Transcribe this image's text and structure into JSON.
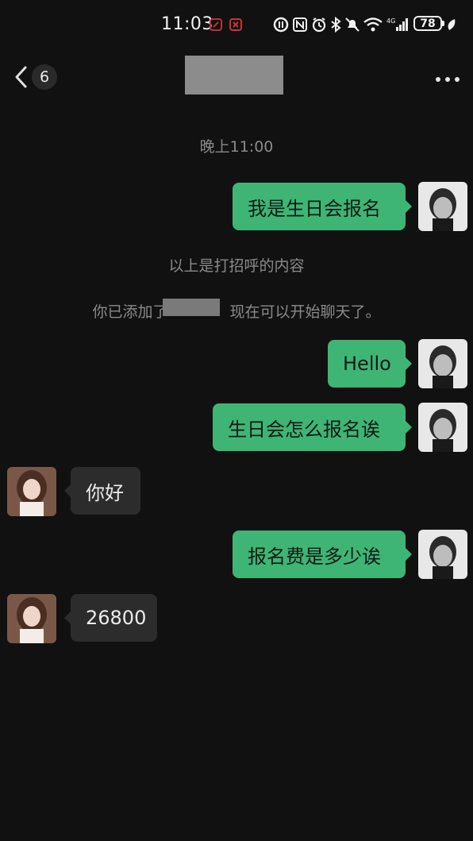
{
  "status_bar": {
    "time": "11:03",
    "battery": "78"
  },
  "nav": {
    "back_badge": "6"
  },
  "chat": {
    "timestamp": "晚上11:00",
    "greeting_note": "以上是打招呼的内容",
    "added_note_prefix": "你已添加了",
    "added_note_suffix": "现在可以开始聊天了。",
    "messages": [
      {
        "from": "me",
        "text": "我是生日会报名"
      },
      {
        "from": "me",
        "text": "Hello"
      },
      {
        "from": "me",
        "text": "生日会怎么报名诶"
      },
      {
        "from": "other",
        "text": "你好"
      },
      {
        "from": "me",
        "text": "报名费是多少诶"
      },
      {
        "from": "other",
        "text": "26800"
      }
    ]
  },
  "colors": {
    "background": "#111111",
    "outgoing_bubble": "#3eb575",
    "incoming_bubble": "#2c2c2c",
    "system_text": "#8a8a8a"
  },
  "icons": {
    "back": "chevron-left-icon",
    "more": "more-dots-icon",
    "wifi": "wifi-icon",
    "signal": "signal-icon",
    "bluetooth": "bluetooth-icon",
    "alarm": "alarm-icon",
    "nfc": "nfc-icon"
  }
}
